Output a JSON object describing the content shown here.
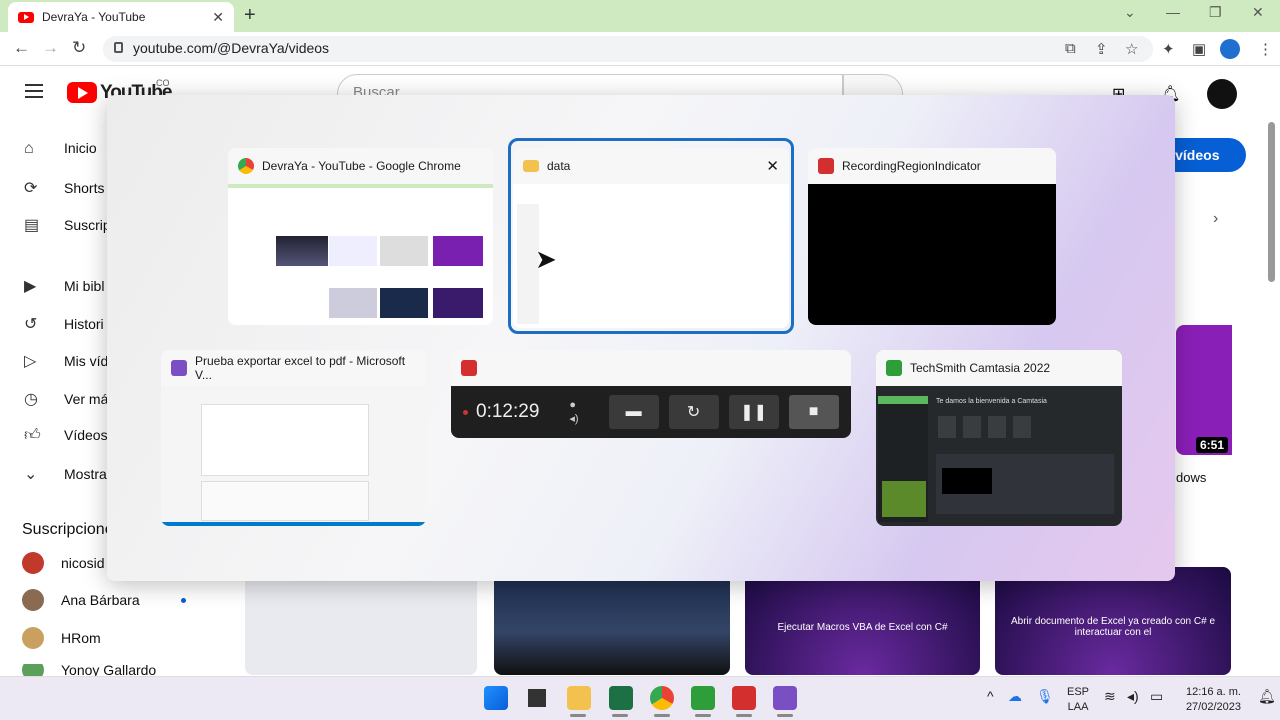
{
  "browser": {
    "tab_title": "DevraYa - YouTube",
    "url": "youtube.com/@DevraYa/videos"
  },
  "youtube": {
    "logo_text": "YouTube",
    "country_code": "CO",
    "search_placeholder": "Buscar",
    "sidebar": [
      {
        "label": "Inicio",
        "icon": "home-icon"
      },
      {
        "label": "Shorts",
        "icon": "shorts-icon"
      },
      {
        "label": "Suscrip",
        "icon": "subscriptions-icon"
      },
      {
        "label": "Mi bibl",
        "icon": "library-icon"
      },
      {
        "label": "Histori",
        "icon": "history-icon"
      },
      {
        "label": "Mis víd",
        "icon": "your-videos-icon"
      },
      {
        "label": "Ver má",
        "icon": "watch-later-icon"
      },
      {
        "label": "Vídeos",
        "icon": "liked-icon"
      },
      {
        "label": "Mostra",
        "icon": "chevron-down-icon"
      }
    ],
    "subscriptions_heading": "Suscripcione",
    "subscriptions": [
      {
        "name": "nicosid",
        "color": "#c0392b"
      },
      {
        "name": "Ana Bárbara",
        "color": "#8a6a50"
      },
      {
        "name": "HRom",
        "color": "#c9a060"
      },
      {
        "name": "Yonoy Gallardo",
        "color": "#5aa05a"
      }
    ],
    "subscribe_label": "ar vídeos",
    "video_duration": "6:51",
    "video_title_fragment": "dows",
    "thumbnails": [
      {
        "title": "",
        "color": "#e8eaf0"
      },
      {
        "title": "",
        "color": "#1a2a4a"
      },
      {
        "title": "Ejecutar Macros VBA de Excel con C#",
        "color": "#2a1a5a"
      },
      {
        "title": "Abrir documento de Excel ya creado con C# e interactuar con el",
        "color": "#2a1a5a"
      }
    ]
  },
  "switcher": {
    "windows": [
      {
        "title": "DevraYa - YouTube - Google Chrome",
        "icon": "chrome-icon"
      },
      {
        "title": "data",
        "icon": "folder-icon"
      },
      {
        "title": "RecordingRegionIndicator",
        "icon": "camtasia-icon"
      },
      {
        "title": "Prueba exportar excel to pdf - Microsoft V...",
        "icon": "visual-studio-icon"
      },
      {
        "title": "",
        "icon": "camtasia-icon"
      },
      {
        "title": "TechSmith Camtasia 2022",
        "icon": "camtasia-icon"
      }
    ],
    "recorder_time": "0:12:29",
    "camtasia_welcome": "Te damos la bienvenida a Camtasia"
  },
  "taskbar": {
    "lang_line1": "ESP",
    "lang_line2": "LAA",
    "time": "12:16 a. m.",
    "date": "27/02/2023"
  }
}
